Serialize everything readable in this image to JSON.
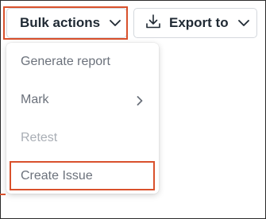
{
  "toolbar": {
    "bulk_actions_label": "Bulk actions",
    "export_label": "Export to"
  },
  "menu": {
    "items": [
      {
        "label": "Generate report",
        "disabled": false
      },
      {
        "label": "Mark",
        "disabled": false,
        "submenu": true
      },
      {
        "label": "Retest",
        "disabled": true
      },
      {
        "label": "Create Issue",
        "disabled": false
      }
    ]
  },
  "colors": {
    "highlight": "#d9512c",
    "text_dark": "#1f2933",
    "text_menu": "#6b717b",
    "text_disabled": "#a9aeb5"
  },
  "icons": {
    "bulk_chevron": "chevron-down-icon",
    "export_download": "download-icon",
    "export_chevron": "chevron-down-icon",
    "mark_submenu": "chevron-right-icon"
  }
}
